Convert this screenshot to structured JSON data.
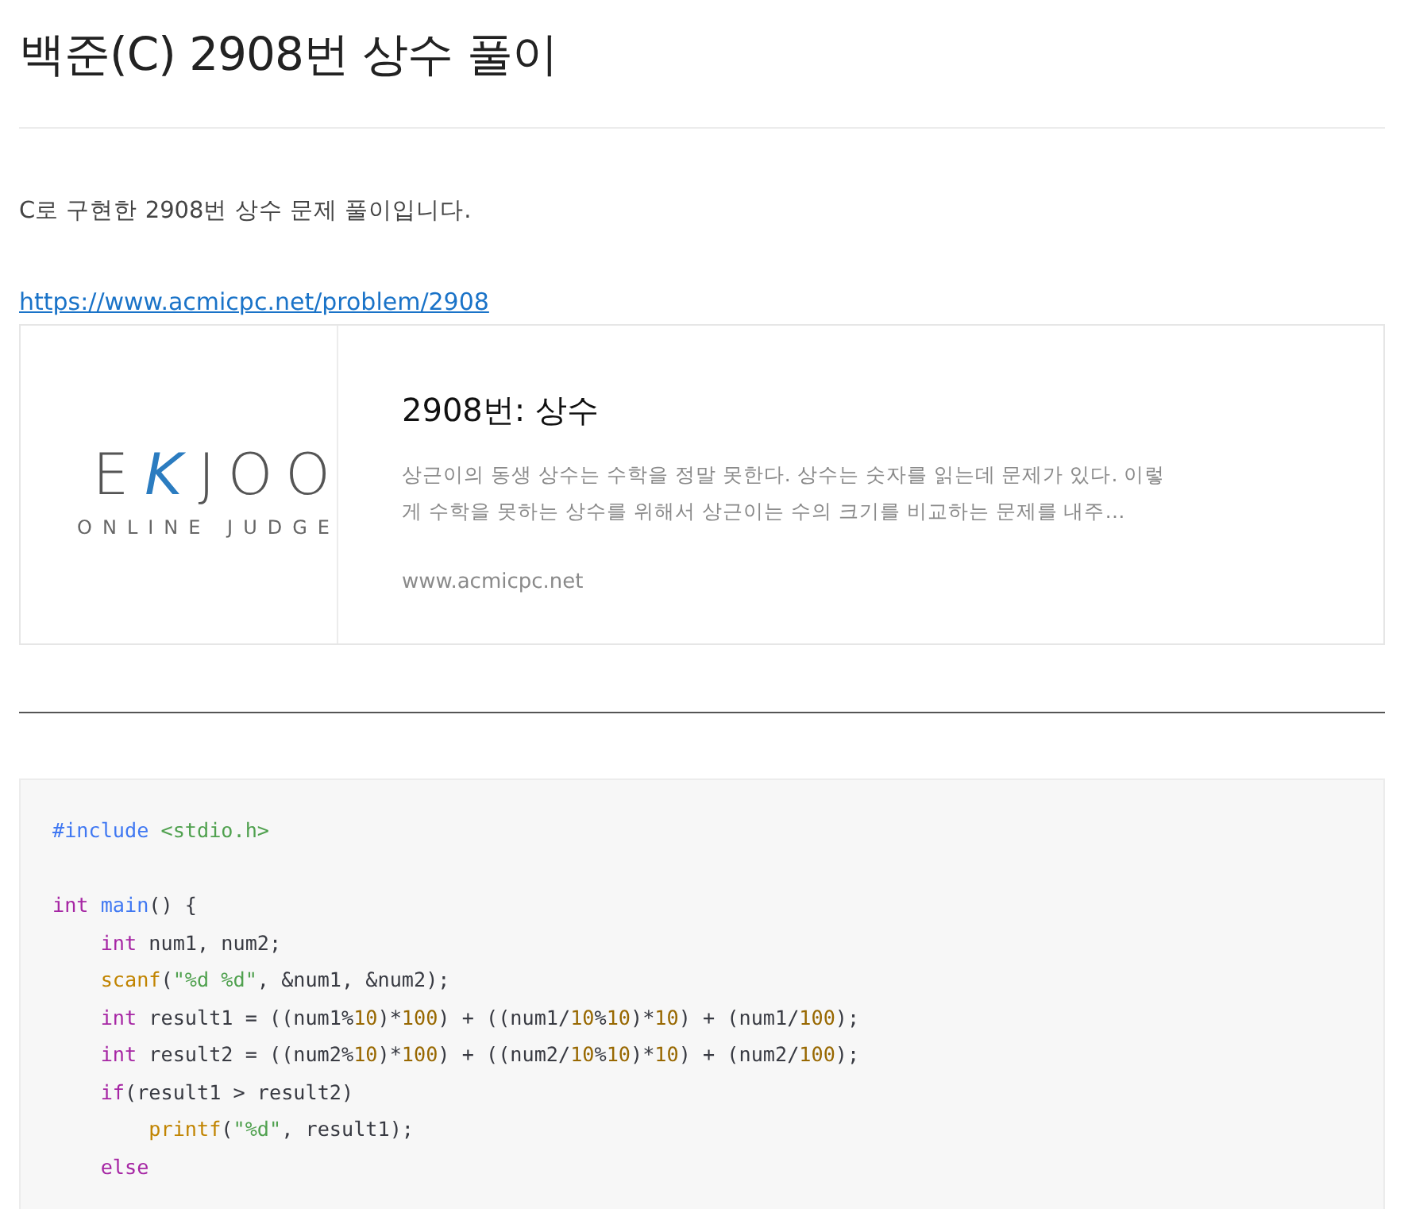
{
  "title": "백준(C) 2908번 상수 풀이",
  "intro": "C로 구현한 2908번 상수 문제 풀이입니다.",
  "link": "https://www.acmicpc.net/problem/2908",
  "card": {
    "wordmark": [
      {
        "text": "E",
        "accent": false
      },
      {
        "text": "K",
        "accent": true
      },
      {
        "text": "JOO",
        "accent": false
      }
    ],
    "tagline": "ONLINE JUDGE",
    "heading": "2908번: 상수",
    "summary": "상근이의 동생 상수는 수학을 정말 못한다. 상수는 숫자를 읽는데 문제가 있다. 이렇게 수학을 못하는 상수를 위해서 상근이는 수의 크기를 비교하는 문제를 내주…",
    "domain": "www.acmicpc.net"
  },
  "code": [
    {
      "gap_before": false,
      "tokens": [
        {
          "t": "#include",
          "color": "#4078f2"
        },
        {
          "t": " <stdio.h>",
          "color": "#50a14f"
        }
      ]
    },
    {
      "gap_before": true,
      "tokens": [
        {
          "t": "int",
          "color": "#a626a4"
        },
        {
          "t": " main",
          "color": "#4078f2"
        },
        {
          "t": "() {",
          "color": "#383a42"
        }
      ]
    },
    {
      "gap_before": false,
      "tokens": [
        {
          "t": "    int",
          "color": "#a626a4"
        },
        {
          "t": " num1, num2;",
          "color": "#383a42"
        }
      ]
    },
    {
      "gap_before": false,
      "tokens": [
        {
          "t": "    scanf",
          "color": "#c18401"
        },
        {
          "t": "(",
          "color": "#383a42"
        },
        {
          "t": "\"%d %d\"",
          "color": "#50a14f"
        },
        {
          "t": ", &num1, &num2);",
          "color": "#383a42"
        }
      ]
    },
    {
      "gap_before": false,
      "tokens": [
        {
          "t": "    int",
          "color": "#a626a4"
        },
        {
          "t": " result1 = ((num1%",
          "color": "#383a42"
        },
        {
          "t": "10",
          "color": "#986801"
        },
        {
          "t": ")*",
          "color": "#383a42"
        },
        {
          "t": "100",
          "color": "#986801"
        },
        {
          "t": ") + ((num1/",
          "color": "#383a42"
        },
        {
          "t": "10",
          "color": "#986801"
        },
        {
          "t": "%",
          "color": "#383a42"
        },
        {
          "t": "10",
          "color": "#986801"
        },
        {
          "t": ")*",
          "color": "#383a42"
        },
        {
          "t": "10",
          "color": "#986801"
        },
        {
          "t": ") + (num1/",
          "color": "#383a42"
        },
        {
          "t": "100",
          "color": "#986801"
        },
        {
          "t": ");",
          "color": "#383a42"
        }
      ]
    },
    {
      "gap_before": false,
      "tokens": [
        {
          "t": "    int",
          "color": "#a626a4"
        },
        {
          "t": " result2 = ((num2%",
          "color": "#383a42"
        },
        {
          "t": "10",
          "color": "#986801"
        },
        {
          "t": ")*",
          "color": "#383a42"
        },
        {
          "t": "100",
          "color": "#986801"
        },
        {
          "t": ") + ((num2/",
          "color": "#383a42"
        },
        {
          "t": "10",
          "color": "#986801"
        },
        {
          "t": "%",
          "color": "#383a42"
        },
        {
          "t": "10",
          "color": "#986801"
        },
        {
          "t": ")*",
          "color": "#383a42"
        },
        {
          "t": "10",
          "color": "#986801"
        },
        {
          "t": ") + (num2/",
          "color": "#383a42"
        },
        {
          "t": "100",
          "color": "#986801"
        },
        {
          "t": ");",
          "color": "#383a42"
        }
      ]
    },
    {
      "gap_before": false,
      "tokens": [
        {
          "t": "    if",
          "color": "#a626a4"
        },
        {
          "t": "(result1 > result2)",
          "color": "#383a42"
        }
      ]
    },
    {
      "gap_before": false,
      "tokens": [
        {
          "t": "        printf",
          "color": "#c18401"
        },
        {
          "t": "(",
          "color": "#383a42"
        },
        {
          "t": "\"%d\"",
          "color": "#50a14f"
        },
        {
          "t": ", result1);",
          "color": "#383a42"
        }
      ]
    },
    {
      "gap_before": false,
      "tokens": [
        {
          "t": "    else",
          "color": "#a626a4"
        }
      ]
    }
  ]
}
